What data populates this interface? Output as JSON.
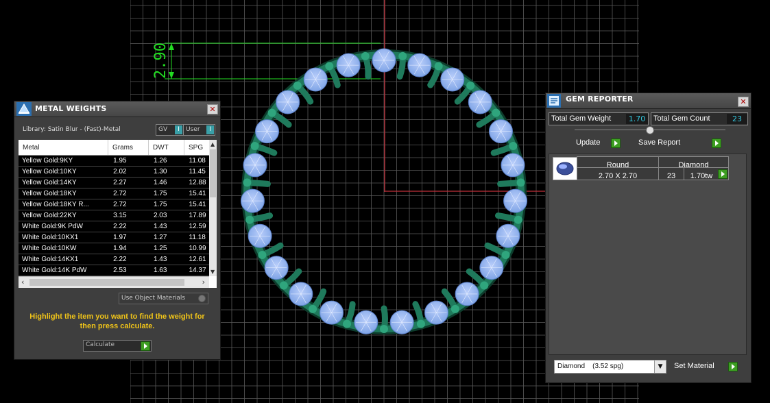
{
  "dimension": {
    "value": "2.90"
  },
  "metal_weights": {
    "title": "METAL WEIGHTS",
    "library": "Library: Satin Blur - (Fast)-Metal",
    "toggle_gv": "GV",
    "toggle_user": "User",
    "columns": [
      "Metal",
      "Grams",
      "DWT",
      "SPG"
    ],
    "rows": [
      [
        "Yellow Gold:9KY",
        "1.95",
        "1.26",
        "11.08"
      ],
      [
        "Yellow Gold:10KY",
        "2.02",
        "1.30",
        "11.45"
      ],
      [
        "Yellow Gold:14KY",
        "2.27",
        "1.46",
        "12.88"
      ],
      [
        "Yellow Gold:18KY",
        "2.72",
        "1.75",
        "15.41"
      ],
      [
        "Yellow Gold:18KY R...",
        "2.72",
        "1.75",
        "15.41"
      ],
      [
        "Yellow Gold:22KY",
        "3.15",
        "2.03",
        "17.89"
      ],
      [
        "White Gold:9K PdW",
        "2.22",
        "1.43",
        "12.59"
      ],
      [
        "White Gold:10KX1",
        "1.97",
        "1.27",
        "11.18"
      ],
      [
        "White Gold:10KW",
        "1.94",
        "1.25",
        "10.99"
      ],
      [
        "White Gold:14KX1",
        "2.22",
        "1.43",
        "12.61"
      ],
      [
        "White Gold:14K PdW",
        "2.53",
        "1.63",
        "14.37"
      ]
    ],
    "use_object_materials": "Use Object Materials",
    "instruction": "Highlight the item you want to find the weight for then press calculate.",
    "calculate_label": "Calculate"
  },
  "gem_reporter": {
    "title": "GEM REPORTER",
    "total_gem_weight_label": "Total Gem Weight",
    "total_gem_weight": "1.70",
    "total_gem_count_label": "Total Gem Count",
    "total_gem_count": "23",
    "update_label": "Update",
    "save_report_label": "Save Report",
    "gem": {
      "shape": "Round",
      "size": "2.70 X 2.70",
      "material": "Diamond",
      "count": "23",
      "weight": "1.70tw"
    },
    "material_select": "Diamond    (3.52 spg)",
    "set_material_label": "Set Material"
  },
  "colors": {
    "grid_line": "#5a5a5a",
    "metal_green": "#1f7a5c",
    "gem_blue": "#7fa4e6",
    "dimension_green": "#22dd22",
    "accent_yellow": "#f0c419",
    "value_cyan": "#33c8e0"
  }
}
